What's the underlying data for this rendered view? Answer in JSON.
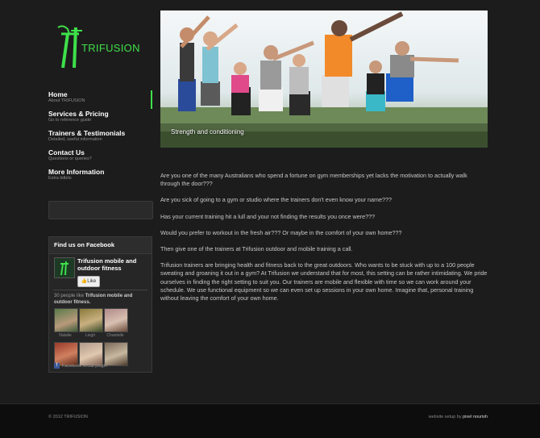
{
  "brand": {
    "name": "TRIFUSION",
    "accent": "#3ee04a"
  },
  "nav": [
    {
      "title": "Home",
      "sub": "About TRIFUSION"
    },
    {
      "title": "Services & Pricing",
      "sub": "Go to reference guide"
    },
    {
      "title": "Trainers & Testimonials",
      "sub": "Detailed, useful information"
    },
    {
      "title": "Contact Us",
      "sub": "Questions or queries?"
    },
    {
      "title": "More Information",
      "sub": "Extra tidbits"
    }
  ],
  "hero": {
    "caption": "Strength and conditioning"
  },
  "content": {
    "paragraphs": [
      "Are you one of the many Australians who spend a fortune on gym memberships yet lacks the motivation to actually walk through the door???",
      "Are you sick of going to a gym or studio where the trainers don't even know your name???",
      "Has your current training hit a lull and your not finding the results you once were???",
      "Would you prefer to workout in the fresh air??? Or maybe in the comfort of your own home???",
      "Then give one of the trainers at Trifusion outdoor and mobile training a call.",
      "Trifusion trainers are bringing health and fitness back to the great outdoors. Who wants to be stuck with up to a 100 people sweating and groaning it out in a gym? At Trifusion we understand that for most, this setting can be rather intimidating. We pride ourselves in finding the right setting to suit you. Our trainers are mobile and flexible with time so we can work around your schedule. We use functional equipment so we can even set up sessions in your own home. Imagine that, personal training without leaving the comfort of your own home."
    ]
  },
  "facebook": {
    "heading": "Find us on Facebook",
    "page_name": "Trifusion mobile and outdoor fitness",
    "like_label": "Like",
    "count_prefix": "30 people like ",
    "count_page": "Trifusion mobile and outdoor fitness.",
    "fans": [
      {
        "name": "Natalie"
      },
      {
        "name": "Leigh"
      },
      {
        "name": "Chantelle"
      }
    ],
    "plugin_label": "Facebook social plugin"
  },
  "footer": {
    "copyright": "© 2012 TRIFUSION",
    "credit_prefix": "website setup by ",
    "credit_name": "pixel nourish"
  }
}
